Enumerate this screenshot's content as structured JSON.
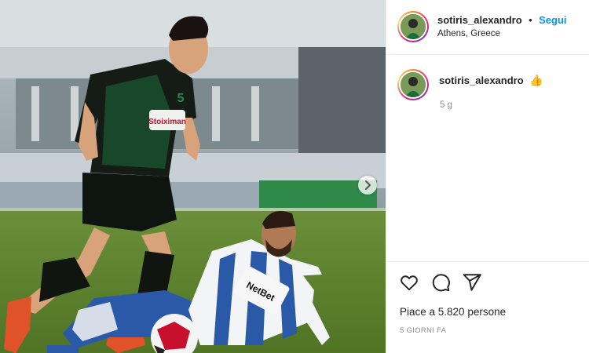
{
  "post": {
    "username": "sotiris_alexandro",
    "separator": "•",
    "follow_label": "Segui",
    "location": "Athens, Greece",
    "caption_emoji": "👍",
    "comment_time": "5 g",
    "likes_text": "Piace a 5.820 persone",
    "date_text": "5 GIORNI FA"
  },
  "photo": {
    "jersey_sponsor": "Stoiximan",
    "jersey_number": "5",
    "opponent_sponsor": "NetBet"
  },
  "icons": {
    "like": "heart-icon",
    "comment": "comment-icon",
    "share": "share-icon",
    "next": "chevron-right-icon"
  },
  "colors": {
    "follow_blue": "#0095f6",
    "panathinaikos_green": "#1e6b3a",
    "opponent_blue": "#2a59a8"
  }
}
